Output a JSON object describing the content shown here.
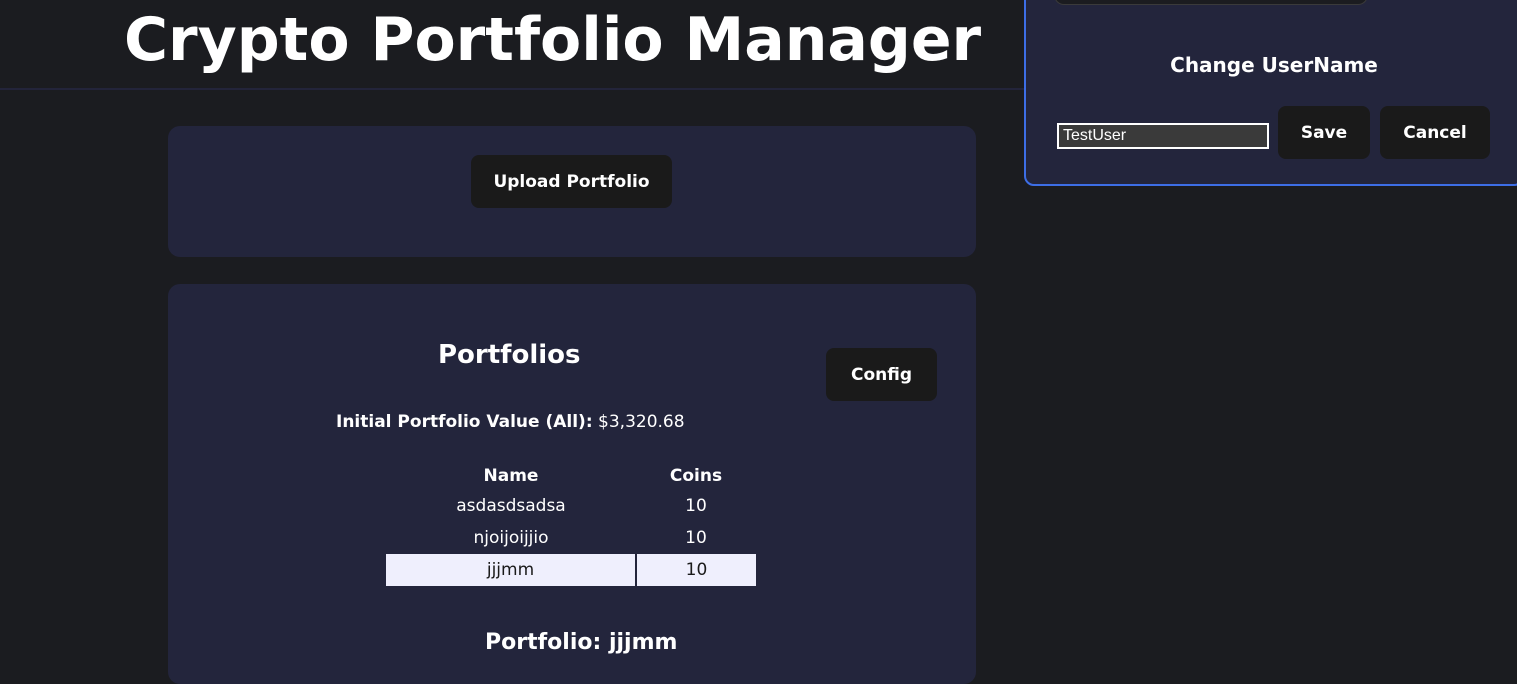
{
  "header": {
    "title": "Crypto Portfolio Manager"
  },
  "upload": {
    "button_label": "Upload Portfolio"
  },
  "portfolios": {
    "heading": "Portfolios",
    "config_label": "Config",
    "initial_value_label": "Initial Portfolio Value (All):",
    "initial_value": "$3,320.68",
    "columns": [
      "Name",
      "Coins"
    ],
    "rows": [
      {
        "name": "asdasdsadsa",
        "coins": "10"
      },
      {
        "name": "njoijoijjio",
        "coins": "10"
      },
      {
        "name": "jjjmm",
        "coins": "10"
      }
    ],
    "selected_row": 2,
    "selected_title": "Portfolio: jjjmm"
  },
  "dialog": {
    "title": "Change UserName",
    "username_value": "TestUser",
    "save_label": "Save",
    "cancel_label": "Cancel"
  },
  "colors": {
    "background": "#1b1c20",
    "card": "#23253c",
    "button": "#1a1a1a",
    "dialog_border": "#3d6ee6",
    "selected_row": "#efeffd"
  }
}
